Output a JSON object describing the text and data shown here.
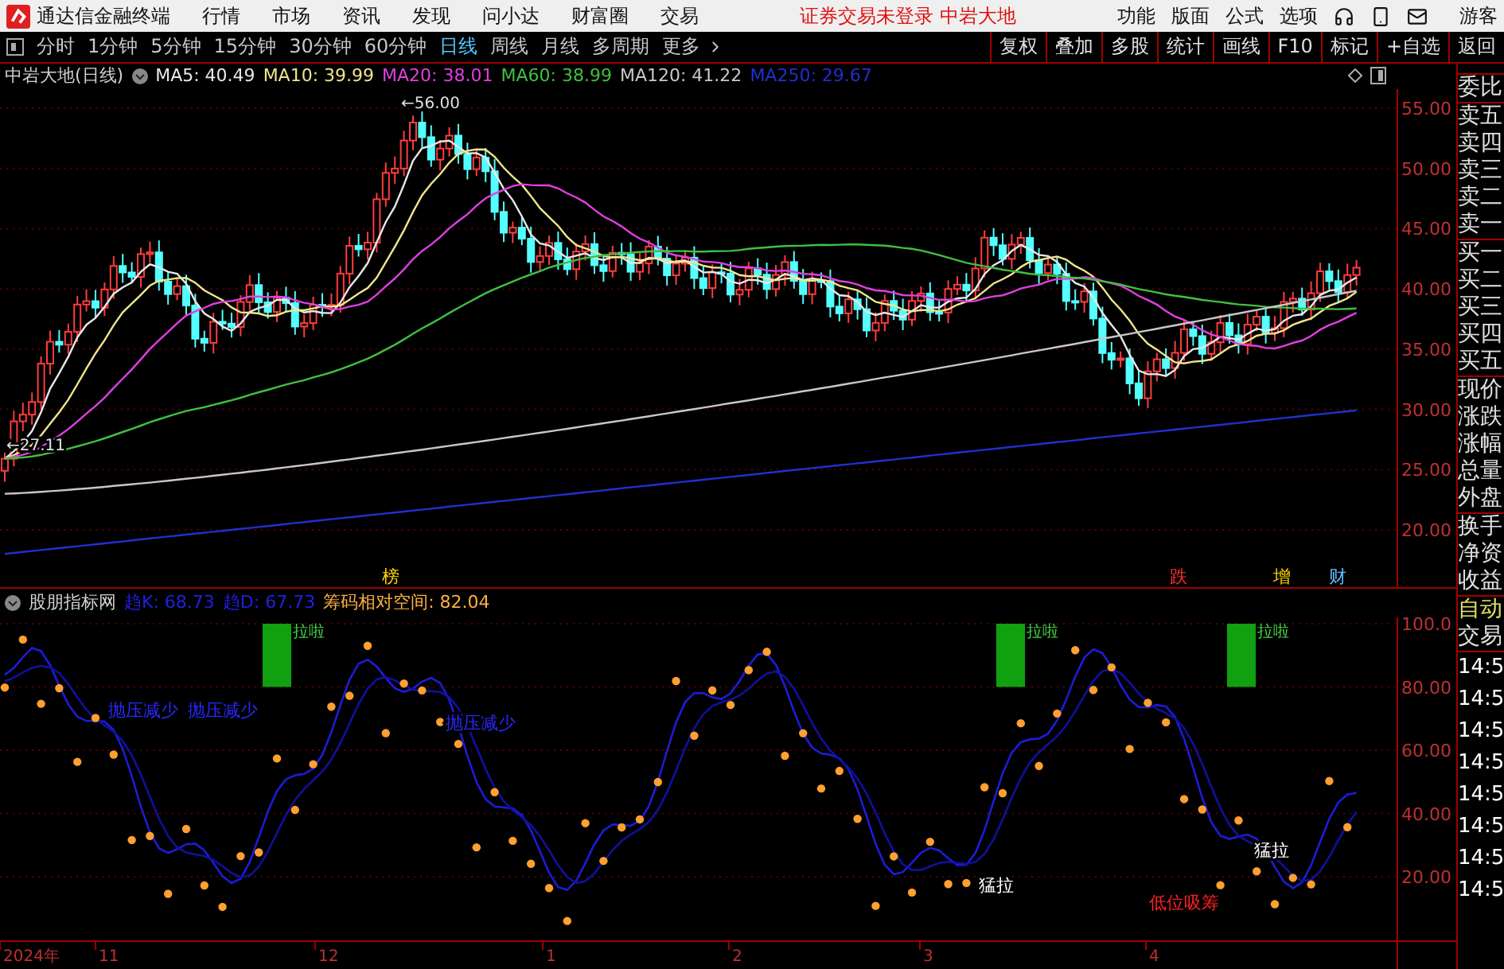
{
  "title_bar": {
    "app_name": "通达信金融终端",
    "menu": [
      "行情",
      "市场",
      "资讯",
      "发现",
      "问小达",
      "财富圈",
      "交易"
    ],
    "notice": "证券交易未登录",
    "stock": "中岩大地",
    "tools": [
      "功能",
      "版面",
      "公式",
      "选项"
    ],
    "user": "游客"
  },
  "toolbar": {
    "periods": [
      {
        "label": "分时",
        "selected": false
      },
      {
        "label": "1分钟",
        "selected": false
      },
      {
        "label": "5分钟",
        "selected": false
      },
      {
        "label": "15分钟",
        "selected": false
      },
      {
        "label": "30分钟",
        "selected": false
      },
      {
        "label": "60分钟",
        "selected": false
      },
      {
        "label": "日线",
        "selected": true
      },
      {
        "label": "周线",
        "selected": false
      },
      {
        "label": "月线",
        "selected": false
      },
      {
        "label": "多周期",
        "selected": false
      }
    ],
    "more": "更多",
    "actions": [
      "复权",
      "叠加",
      "多股",
      "统计",
      "画线",
      "F10",
      "标记",
      "+自选",
      "返回"
    ]
  },
  "price_chart": {
    "title": "中岩大地(日线)",
    "ma": [
      {
        "label": "MA5: 40.49",
        "color": "#e8e8e8"
      },
      {
        "label": "MA10: 39.99",
        "color": "#f0e68c"
      },
      {
        "label": "MA20: 38.01",
        "color": "#e040e0"
      },
      {
        "label": "MA60: 38.99",
        "color": "#40c040"
      },
      {
        "label": "MA120: 41.22",
        "color": "#c8c8c8"
      },
      {
        "label": "MA250: 29.67",
        "color": "#2030d0"
      }
    ],
    "high": "←56.00",
    "low": "←27.11",
    "y_ticks": [
      "55.00",
      "50.00",
      "45.00",
      "40.00",
      "35.00",
      "30.00",
      "25.00",
      "20.00"
    ],
    "signals": [
      {
        "text": "榜",
        "color": "#ffd200"
      },
      {
        "text": "跌",
        "color": "#ff3030"
      },
      {
        "text": "增",
        "color": "#ffd200"
      },
      {
        "text": "财",
        "color": "#60c0ff"
      }
    ]
  },
  "indicator": {
    "name": "股朋指标网",
    "values": [
      {
        "label": "趋K: 68.73",
        "color": "#2020e0"
      },
      {
        "label": "趋D: 67.73",
        "color": "#2020e0"
      },
      {
        "label": "筹码相对空间: 82.04",
        "color": "#ffb040"
      }
    ],
    "y_ticks": [
      "100.0",
      "80.00",
      "60.00",
      "40.00",
      "20.00"
    ],
    "bar_label": [
      "拉啦",
      "拉啦",
      "拉啦"
    ],
    "notes": [
      {
        "text": "抛压减少",
        "kind": "blue"
      },
      {
        "text": "抛压减少",
        "kind": "blue"
      },
      {
        "text": "抛压减少",
        "kind": "blue"
      },
      {
        "text": "猛拉",
        "kind": "white"
      },
      {
        "text": "猛拉",
        "kind": "white"
      },
      {
        "text": "低位吸筹",
        "kind": "red"
      }
    ]
  },
  "x_ticks": [
    "2024年",
    "11",
    "12",
    "1",
    "2",
    "3",
    "4"
  ],
  "side_panel": {
    "groups": [
      [
        "委比"
      ],
      [
        "卖五",
        "卖四",
        "卖三",
        "卖二",
        "卖一"
      ],
      [
        "买一",
        "买二",
        "买三",
        "买四",
        "买五"
      ],
      [
        "现价",
        "涨跌",
        "涨幅",
        "总量",
        "外盘"
      ],
      [
        "换手",
        "净资",
        "收益"
      ]
    ],
    "trade": [
      "自动",
      "交易"
    ],
    "times": [
      "14:5",
      "14:5",
      "14:5",
      "14:5",
      "14:5",
      "14:5",
      "14:5",
      "14:5"
    ]
  }
}
